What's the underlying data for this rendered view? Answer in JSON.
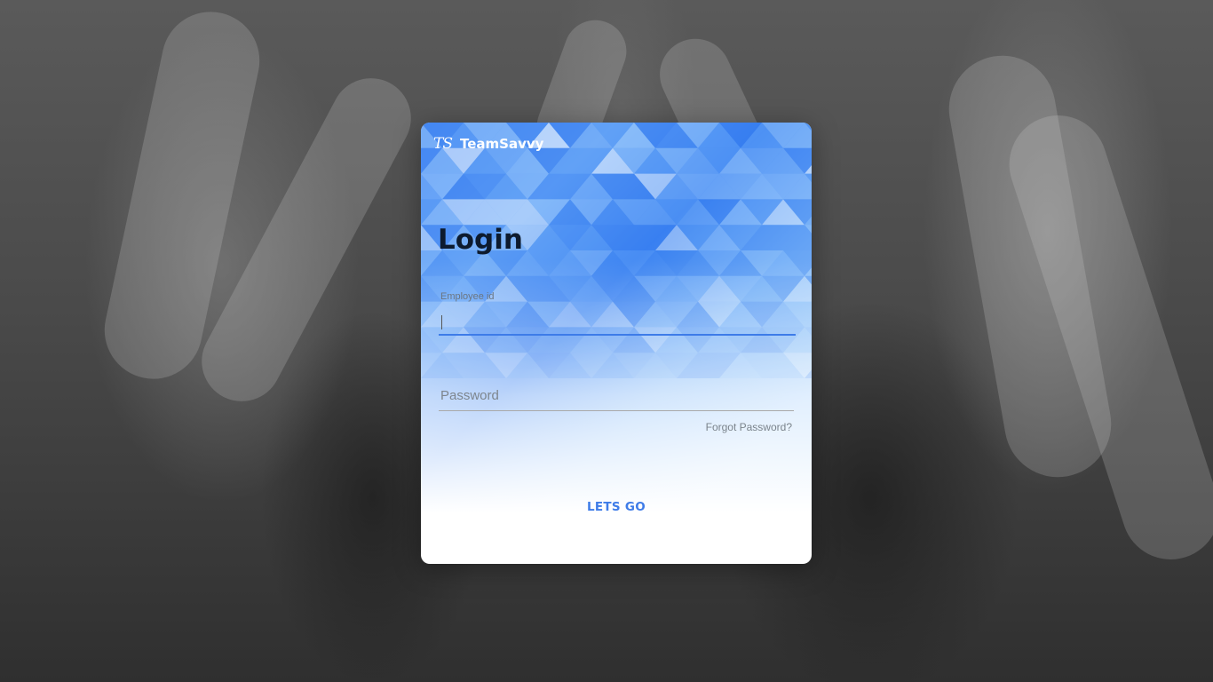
{
  "brand": {
    "logo": "TS",
    "name": "TeamSavvy"
  },
  "login": {
    "title": "Login",
    "employee_label": "Employee id",
    "employee_value": "",
    "password_placeholder": "Password",
    "password_value": "",
    "forgot_label": "Forgot Password?",
    "submit_label": "LETS GO"
  },
  "colors": {
    "accent": "#3e7ce8",
    "title": "#0d1b2e",
    "pattern_blue": "#4d8ef3"
  },
  "icons": {
    "logo": "ts-logo-icon"
  }
}
